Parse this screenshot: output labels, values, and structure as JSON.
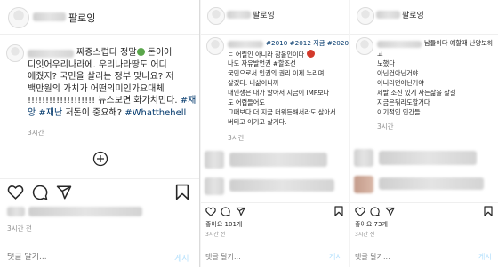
{
  "panels": [
    {
      "username_suffix": "팔로잉",
      "caption_lines": [
        {
          "pre": "짜증스럽다 정말",
          "emoji": "green",
          "post": " 돈이어"
        },
        {
          "pre": "디잇어우리나라에. 우리나라땅도 어디"
        },
        {
          "pre": "에줬지? 국민을 살리는 정부 맞나요? 저"
        },
        {
          "pre": "백만원의 가치가 어떤의미인가요대체"
        },
        {
          "pre": "!!!!!!!!!!!!!!!!!!! 뉴스보면 화가치민다. ",
          "tag": "#재"
        },
        {
          "tag_pre": "앙",
          "tag": " #재난",
          "mid": " 저돈이 중요해?",
          "tag2": " #Whatthehell"
        }
      ],
      "timestamp": "3시간",
      "icons": [
        "heart-icon",
        "comment-icon",
        "share-icon",
        "bookmark-icon"
      ],
      "post_time": "3시간 전",
      "comment_placeholder": "댓글 달기...",
      "post_button": "게시"
    },
    {
      "username_suffix": "팔로잉",
      "hashtags": "#2010 #2012 지금 #2020",
      "caption_lines": [
        "ㄷ 어릴인 아니라 참올인이다",
        "나도 자유발언권 #할조선",
        "국민으로서 인권의 권리 이제 누리며",
        "살겠다. 내삶이니까",
        "내인생은 내가 알아서 지금이 IMF보다",
        "도 어렵들어도",
        "그때보다 더 지금 더워든해서라도 살아서",
        "버티고 이기고 살거다."
      ],
      "timestamp": "3시간",
      "likes": "좋아요 101개",
      "post_time": "3시간 전",
      "comment_placeholder": "댓글 달기...",
      "post_button": "게시"
    },
    {
      "username_suffix": "팔로잉",
      "caption_lines": [
        "남들이다 예할때 난양보하",
        "고",
        "노했다",
        "아닌건아닌거야",
        "아니라면아닌거야",
        "제발 소신 있게 사는삶을 살길",
        "지금은뭐라도할거다",
        "이기적인 인간들"
      ],
      "timestamp": "3시간",
      "likes": "좋아요 73개",
      "post_time": "3시간 전",
      "comment_placeholder": "댓글 달기...",
      "post_button": "게시"
    }
  ],
  "colors": {
    "hashtag": "#00376b",
    "muted": "#8e8e8e",
    "post_button": "#b2dffc"
  }
}
